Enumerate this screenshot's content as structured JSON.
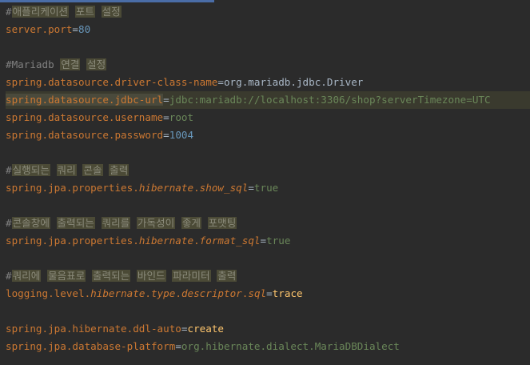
{
  "lines": {
    "l1": {
      "hash": "#",
      "w1": "애플리케이션",
      "w2": "포트",
      "w3": "설정"
    },
    "l2": {
      "key": "server.port",
      "eq": "=",
      "val": "80"
    },
    "l4": {
      "hash": "#",
      "text": "Mariadb",
      "w1": "연결",
      "w2": "설정"
    },
    "l5": {
      "key": "spring.datasource.driver-class-name",
      "eq": "=",
      "val": "org.mariadb.jdbc.Driver"
    },
    "l6": {
      "key": "spring.datasource.jdbc-url",
      "eq": "=",
      "val": "jdbc:mariadb://localhost:3306/shop?serverTimezone=UTC"
    },
    "l7": {
      "key": "spring.datasource.username",
      "eq": "=",
      "val": "root"
    },
    "l8": {
      "key": "spring.datasource.password",
      "eq": "=",
      "val": "1004"
    },
    "l10": {
      "hash": "#",
      "w1": "실행되는",
      "w2": "쿼리",
      "w3": "콘솔",
      "w4": "출력"
    },
    "l11": {
      "k1": "spring.jpa.properties.",
      "k2": "hibernate",
      "k3": ".",
      "k4": "show_sql",
      "eq": "=",
      "val": "true"
    },
    "l13": {
      "hash": "#",
      "w1": "콘솔창에",
      "w2": "출력되는",
      "w3": "쿼리를",
      "w4": "가독성이",
      "w5": "좋게",
      "w6": "포맷팅"
    },
    "l14": {
      "k1": "spring.jpa.properties.",
      "k2": "hibernate",
      "k3": ".",
      "k4": "format_sql",
      "eq": "=",
      "val": "true"
    },
    "l16": {
      "hash": "#",
      "w1": "쿼리에",
      "w2": "물음표로",
      "w3": "출력되는",
      "w4": "바인드",
      "w5": "파라미터",
      "w6": "출력"
    },
    "l17": {
      "k1": "logging.level.",
      "k2": "hibernate",
      "k3": ".",
      "k4": "type",
      "k5": ".",
      "k6": "descriptor",
      "k7": ".",
      "k8": "sql",
      "eq": "=",
      "val": "trace"
    },
    "l19": {
      "key": "spring.jpa.hibernate.ddl-auto",
      "eq": "=",
      "val": "create"
    },
    "l20": {
      "key": "spring.jpa.database-platform",
      "eq": "=",
      "val": "org.hibernate.dialect.MariaDBDialect"
    }
  },
  "colors": {
    "background": "#2b2b2b",
    "property_key": "#cc7832",
    "string_value": "#6a8759",
    "number_value": "#6897bb",
    "keyword_value": "#ffc66d",
    "comment": "#808080"
  }
}
